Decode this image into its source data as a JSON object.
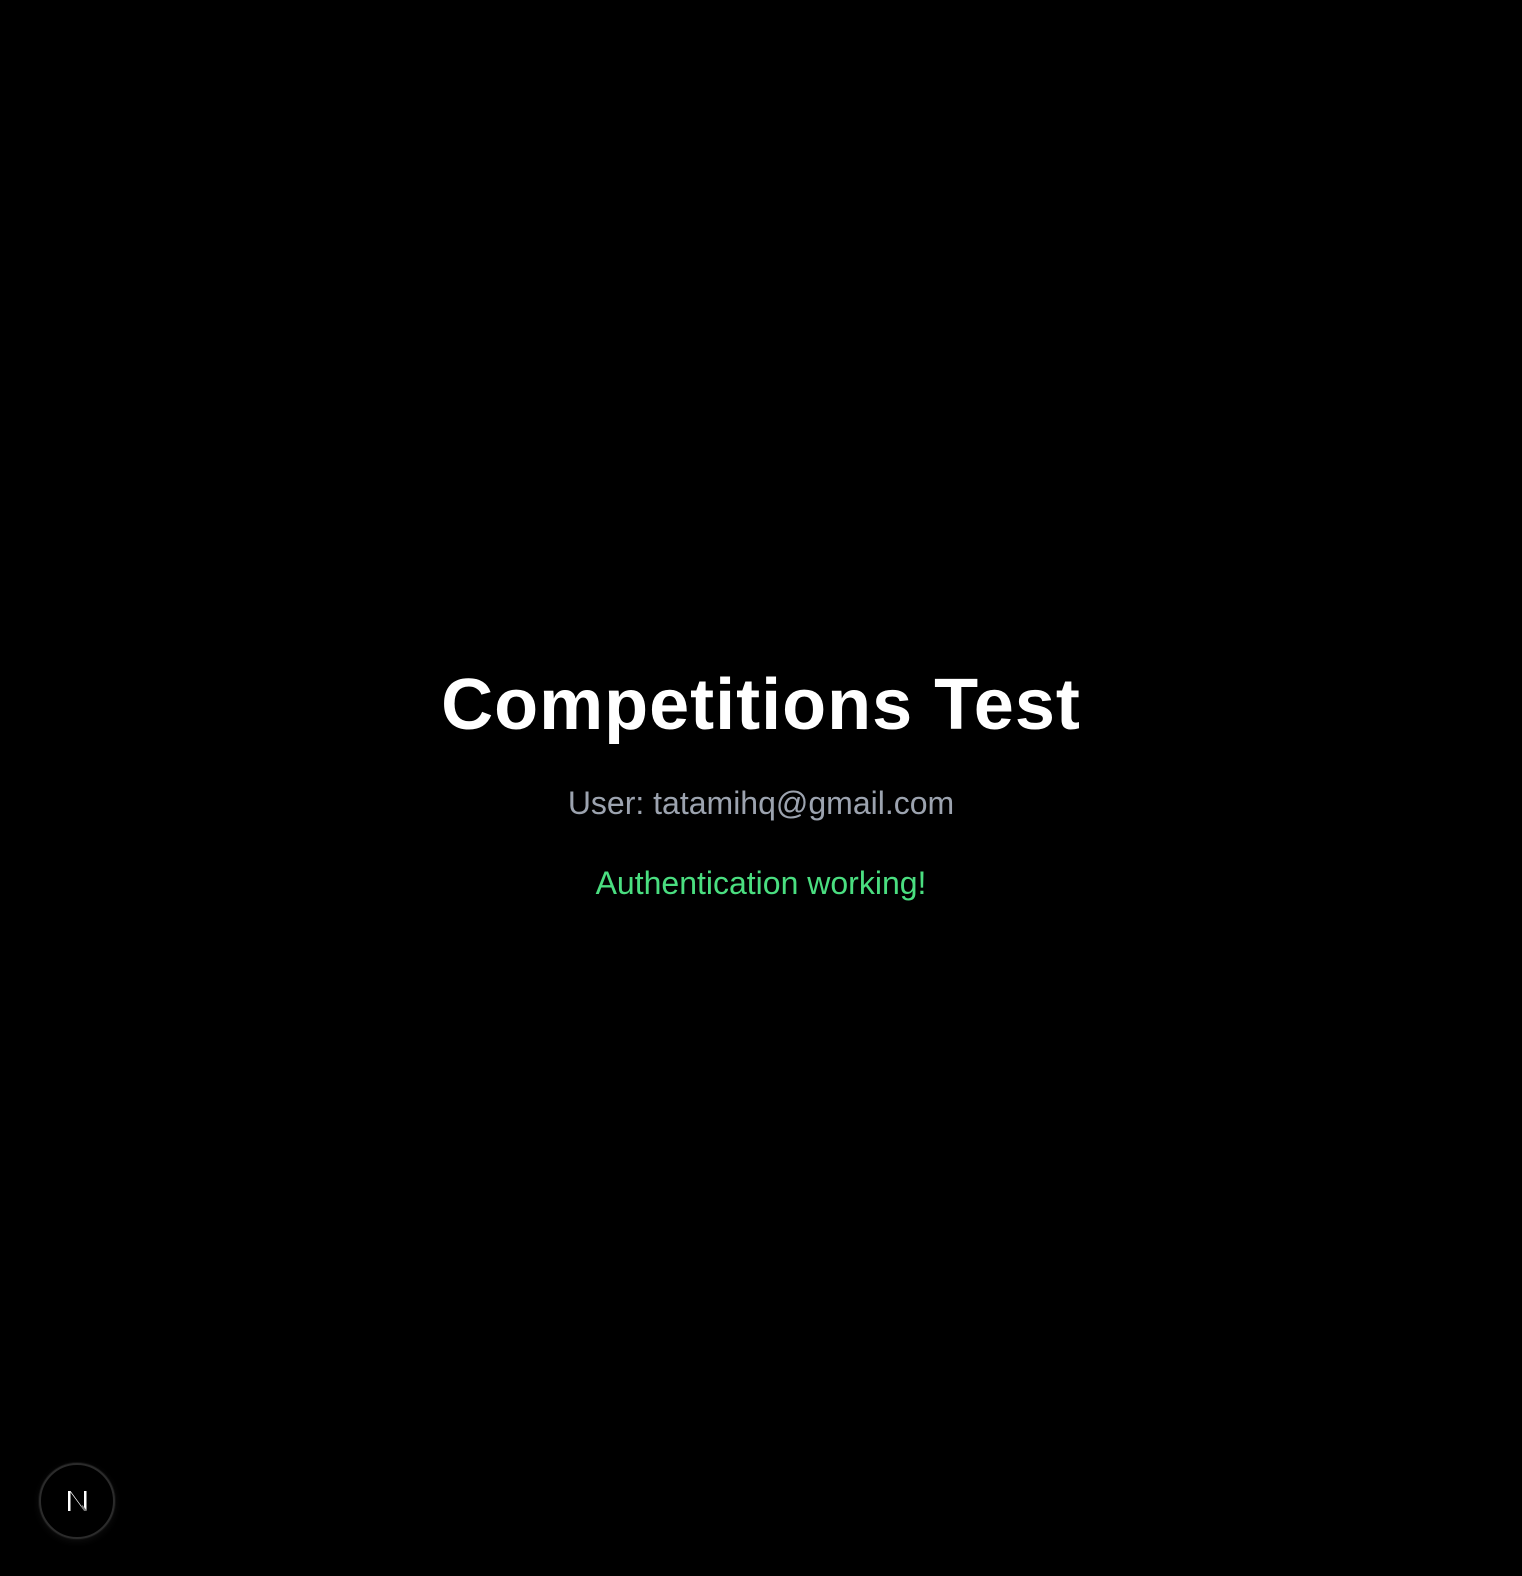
{
  "main": {
    "title": "Competitions Test",
    "user_line": "User: tatamihq@gmail.com",
    "status": "Authentication working!"
  },
  "devtools": {
    "icon": "nextjs-logo-icon"
  },
  "colors": {
    "background": "#000000",
    "title": "#ffffff",
    "user_text": "#9ca3af",
    "status_success": "#4ade80"
  }
}
